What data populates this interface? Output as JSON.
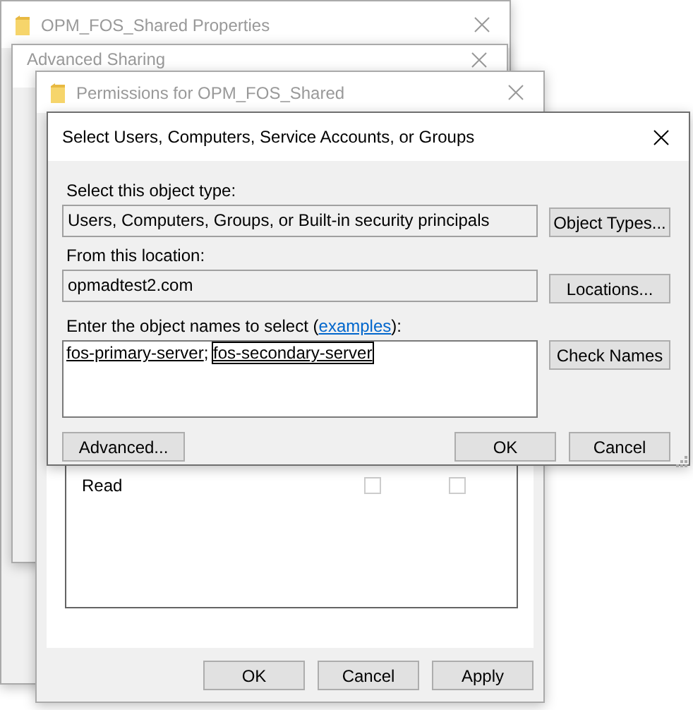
{
  "windows": [
    {
      "kind": "properties",
      "title": "OPM_FOS_Shared Properties",
      "active": false,
      "icon": true
    },
    {
      "kind": "advanced_sharing",
      "title": "Advanced Sharing",
      "active": false,
      "icon": false
    },
    {
      "kind": "permissions",
      "title": "Permissions for OPM_FOS_Shared",
      "active": false,
      "icon": true,
      "permissions": [
        {
          "name": "Read",
          "allow": false,
          "deny": false
        }
      ],
      "buttons": [
        "OK",
        "Cancel",
        "Apply"
      ]
    }
  ],
  "dialog": {
    "title": "Select Users, Computers, Service Accounts, or Groups",
    "active": true,
    "object_type": {
      "label": "Select this object type:",
      "value": "Users, Computers, Groups, or Built-in security principals",
      "button": "Object Types..."
    },
    "location": {
      "label": "From this location:",
      "value": "opmadtest2.com",
      "button": "Locations..."
    },
    "names": {
      "label_before": "Enter the object names to select (",
      "link": "examples",
      "label_after": "):",
      "separator": "; ",
      "button": "Check Names",
      "entries": [
        {
          "name": "fos-primary-server",
          "selected": false
        },
        {
          "name": "fos-secondary-server",
          "selected": true
        }
      ]
    },
    "buttons": [
      {
        "kind": "advanced",
        "label": "Advanced..."
      },
      {
        "kind": "ok",
        "label": "OK"
      },
      {
        "kind": "cancel",
        "label": "Cancel"
      }
    ]
  }
}
